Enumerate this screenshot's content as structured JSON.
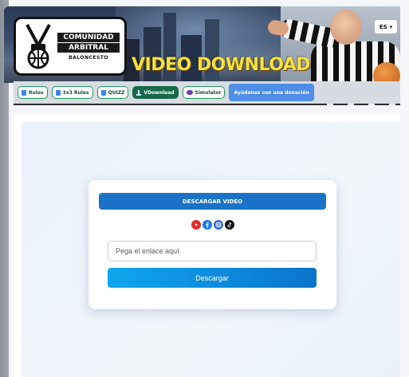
{
  "header": {
    "logo_line1": "COMUNIDAD",
    "logo_line2": "ARBITRAL",
    "logo_sub": "BALONCESTO",
    "title": "VIDEO DOWNLOAD",
    "language": "ES",
    "title_color": "#f7e23a"
  },
  "nav": {
    "items": [
      {
        "label": "Rules",
        "icon": "book-icon"
      },
      {
        "label": "3x3 Rules",
        "icon": "book-icon"
      },
      {
        "label": "QUIZZ",
        "icon": "book-icon"
      },
      {
        "label": "VDownload",
        "icon": "download-icon",
        "active": true
      },
      {
        "label": "Simulator",
        "icon": "mask-icon"
      }
    ],
    "donate_label": "Ayúdanos con una donación",
    "active_color": "#17694a",
    "donate_color": "#4e8de8"
  },
  "card": {
    "header_label": "DESCARGAR VIDEO",
    "socials": [
      "youtube-icon",
      "facebook-icon",
      "instagram-icon",
      "tiktok-icon"
    ],
    "input_placeholder": "Pega el enlace aquí",
    "input_value": "",
    "button_label": "Descargar",
    "accent_color": "#1a73c6"
  }
}
